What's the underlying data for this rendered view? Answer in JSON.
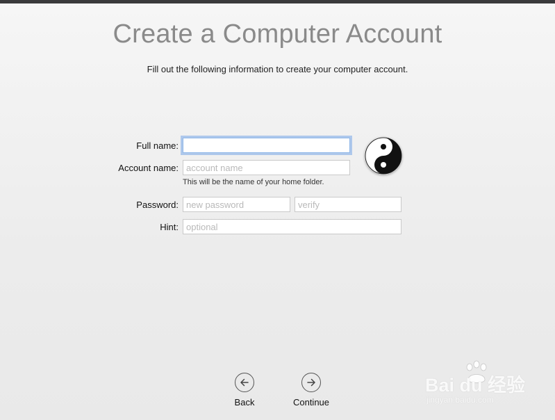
{
  "title": "Create a Computer Account",
  "subtitle": "Fill out the following information to create your computer account.",
  "form": {
    "full_name_label": "Full name:",
    "full_name_value": "",
    "account_name_label": "Account name:",
    "account_name_placeholder": "account name",
    "account_help": "This will be the name of your home folder.",
    "password_label": "Password:",
    "password_placeholder": "new password",
    "verify_placeholder": "verify",
    "hint_label": "Hint:",
    "hint_placeholder": "optional"
  },
  "avatar_icon": "yin-yang-icon",
  "nav": {
    "back_label": "Back",
    "back_icon": "arrow-left-circle-icon",
    "continue_label": "Continue",
    "continue_icon": "arrow-right-circle-icon"
  },
  "watermark": {
    "brand": "Bai du 经验",
    "url": "jingyan.baidu.com"
  },
  "colors": {
    "focus_ring": "#8fb7e8",
    "title": "#8a8a8a",
    "top_bar": "#3a3a3c"
  }
}
